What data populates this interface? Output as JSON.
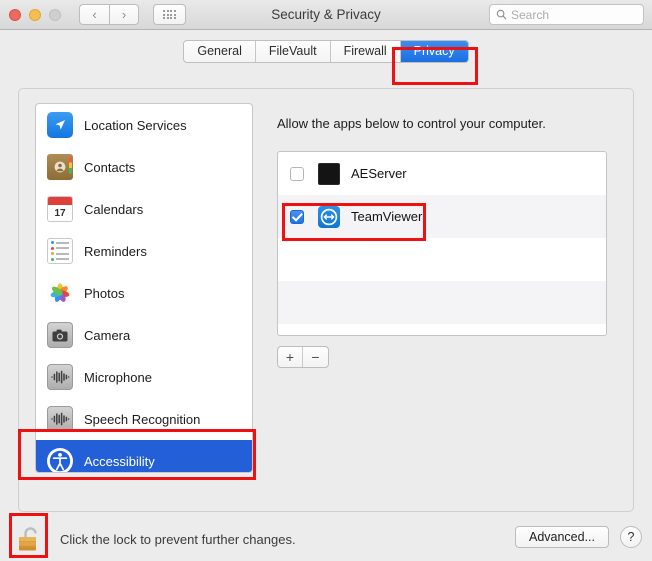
{
  "window": {
    "title": "Security & Privacy",
    "traffic_lights": [
      "close-red",
      "minimize-yellow",
      "zoom-disabled-gray"
    ],
    "nav": {
      "back": "‹",
      "forward": "›"
    },
    "grid_button": "all-preferences-grid"
  },
  "search": {
    "placeholder": "Search",
    "value": "",
    "icon": "search-icon"
  },
  "tabs": [
    {
      "label": "General",
      "active": false
    },
    {
      "label": "FileVault",
      "active": false
    },
    {
      "label": "Firewall",
      "active": false
    },
    {
      "label": "Privacy",
      "active": true
    }
  ],
  "sidebar": {
    "items": [
      {
        "label": "Location Services",
        "icon": "location-services-icon",
        "selected": false
      },
      {
        "label": "Contacts",
        "icon": "contacts-icon",
        "selected": false
      },
      {
        "label": "Calendars",
        "icon": "calendars-icon",
        "selected": false,
        "day": "17"
      },
      {
        "label": "Reminders",
        "icon": "reminders-icon",
        "selected": false
      },
      {
        "label": "Photos",
        "icon": "photos-icon",
        "selected": false
      },
      {
        "label": "Camera",
        "icon": "camera-icon",
        "selected": false
      },
      {
        "label": "Microphone",
        "icon": "microphone-icon",
        "selected": false
      },
      {
        "label": "Speech Recognition",
        "icon": "speech-recognition-icon",
        "selected": false
      },
      {
        "label": "Accessibility",
        "icon": "accessibility-icon",
        "selected": true
      }
    ]
  },
  "content": {
    "heading": "Allow the apps below to control your computer.",
    "apps": [
      {
        "name": "AEServer",
        "checked": false,
        "icon": "aeserver-terminal-icon"
      },
      {
        "name": "TeamViewer",
        "checked": true,
        "icon": "teamviewer-icon"
      }
    ],
    "add_button": "+",
    "remove_button": "−"
  },
  "footer": {
    "lock_icon": "unlocked-padlock-icon",
    "lock_text": "Click the lock to prevent further changes.",
    "advanced_label": "Advanced...",
    "help_label": "?"
  },
  "colors": {
    "accent_blue": "#2360d8",
    "tab_blue": "#2a7ae8",
    "annotation_red": "#ee1111",
    "window_bg": "#ececec"
  }
}
